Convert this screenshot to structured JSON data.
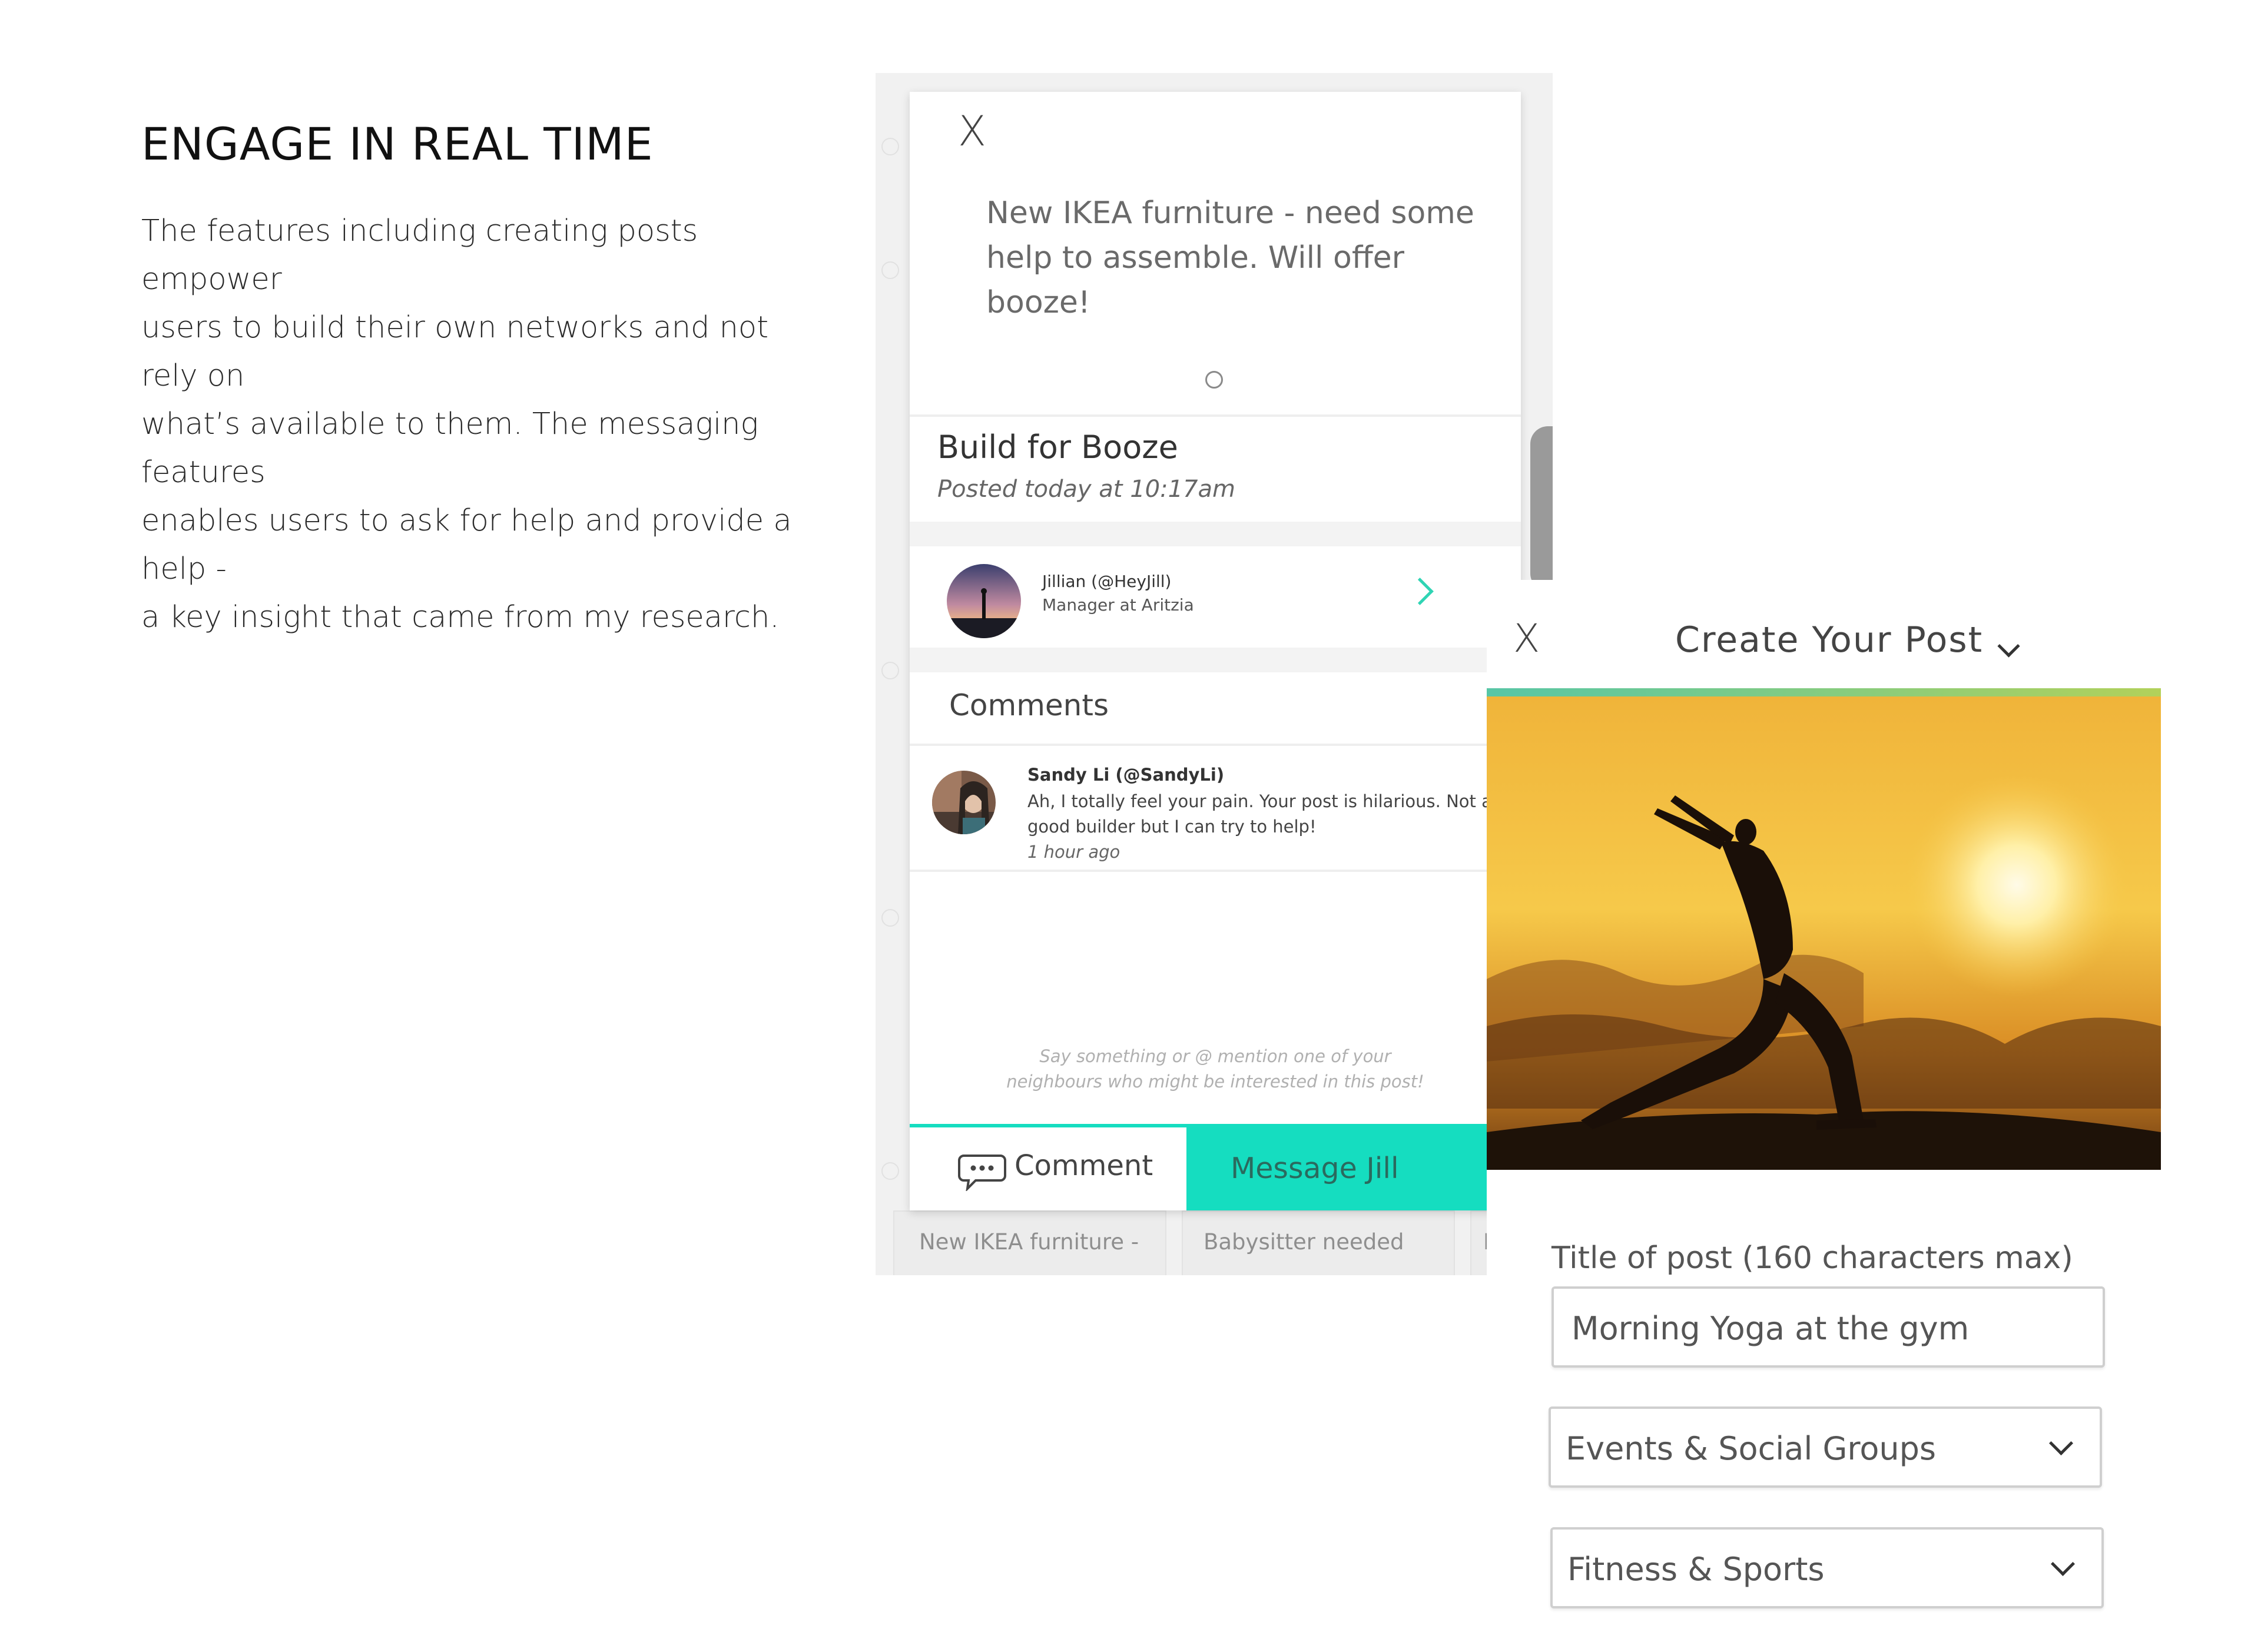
{
  "intro": {
    "title": "ENGAGE IN REAL TIME",
    "lines": [
      "The features including creating posts empower",
      "users to build their own networks and not rely on",
      "what’s available to them. The messaging features",
      "enables users to ask for help and provide a help -",
      "a key insight that came from my research."
    ]
  },
  "background_cards": [
    "New IKEA furniture -",
    "Babysitter needed",
    "H"
  ],
  "post_detail": {
    "close": "X",
    "body": "New IKEA furniture - need some help to assemble. Will offer booze!",
    "title": "Build for Booze",
    "posted": "Posted today at 10:17am",
    "author": {
      "name": "Jillian (@HeyJill)",
      "role": "Manager at Aritzia"
    },
    "comments_header": "Comments",
    "comment": {
      "name": "Sandy Li (@SandyLi)",
      "text": "Ah, I totally feel your pain. Your post is hilarious. Not a good builder but I can try to help!",
      "time": "1 hour ago"
    },
    "placeholder_lines": [
      "Say something or @ mention one of your",
      "neighbours who might be interested in this post!"
    ],
    "comment_button": "Comment",
    "message_button": "Message Jill",
    "accent_color": "#15ddc0"
  },
  "create_post": {
    "close": "X",
    "title": "Create Your Post",
    "title_label": "Title of post (160 characters max)",
    "title_value": "Morning Yoga at the gym",
    "category_value": "Events & Social Groups",
    "subcategory_value": "Fitness & Sports"
  }
}
